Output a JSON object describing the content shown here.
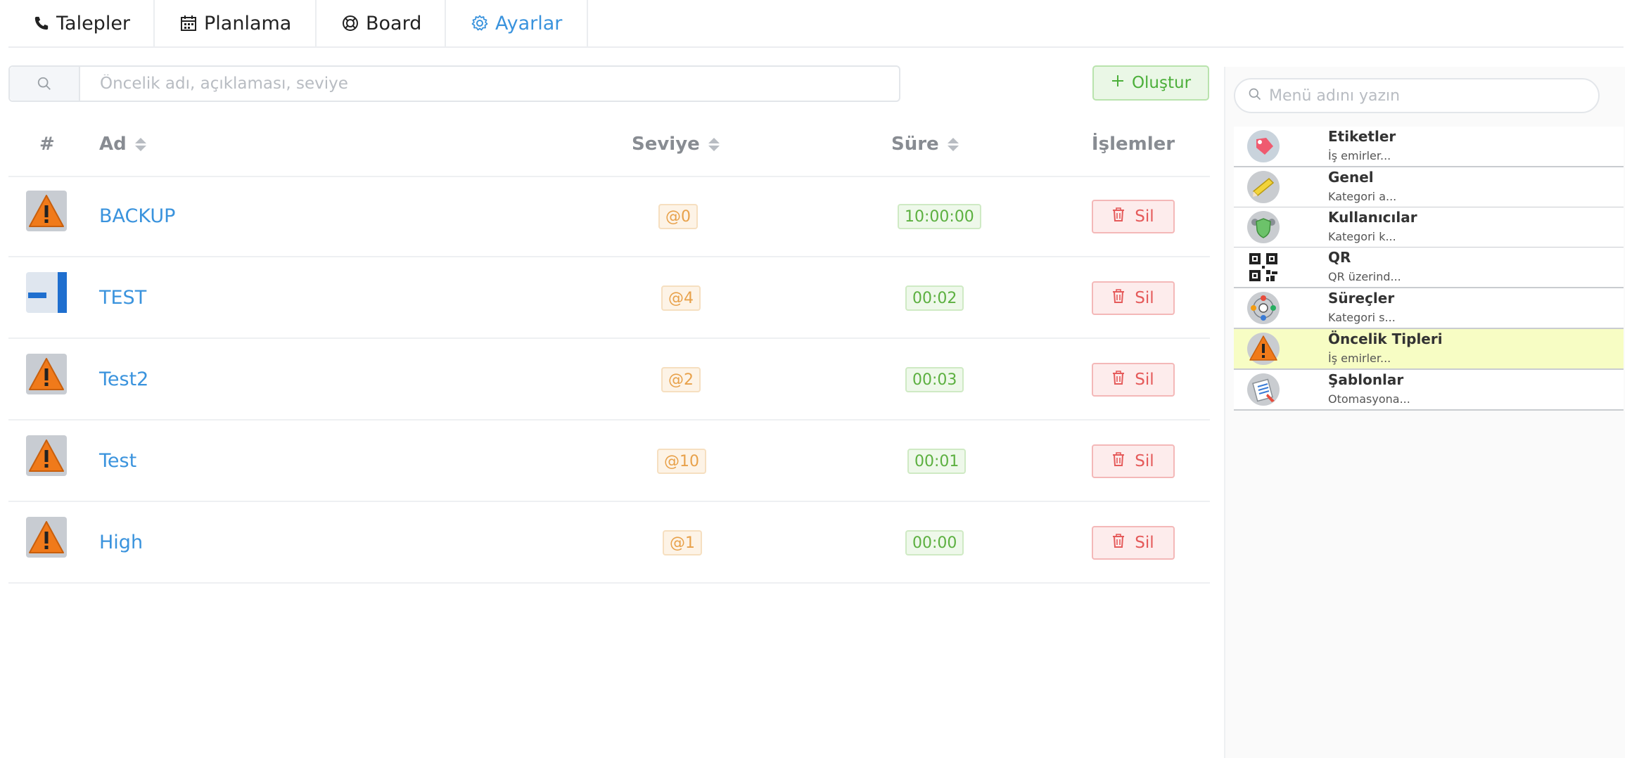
{
  "tabs": [
    {
      "label": "Talepler",
      "icon": "phone-icon",
      "active": false
    },
    {
      "label": "Planlama",
      "icon": "calendar-icon",
      "active": false
    },
    {
      "label": "Board",
      "icon": "lifebuoy-icon",
      "active": false
    },
    {
      "label": "Ayarlar",
      "icon": "gear-icon",
      "active": true
    }
  ],
  "search": {
    "placeholder": "Öncelik adı, açıklaması, seviye"
  },
  "toolbar": {
    "create_label": "Oluştur"
  },
  "table": {
    "headers": {
      "index": "#",
      "name": "Ad",
      "level": "Seviye",
      "duration": "Süre",
      "actions": "İşlemler"
    },
    "rows": [
      {
        "icon": "warning-icon",
        "name": "BACKUP",
        "level": "@0",
        "duration": "10:00:00",
        "delete": "Sil"
      },
      {
        "icon": "blue-square-icon",
        "name": "TEST",
        "level": "@4",
        "duration": "00:02",
        "delete": "Sil"
      },
      {
        "icon": "warning-icon",
        "name": "Test2",
        "level": "@2",
        "duration": "00:03",
        "delete": "Sil"
      },
      {
        "icon": "warning-icon",
        "name": "Test",
        "level": "@10",
        "duration": "00:01",
        "delete": "Sil"
      },
      {
        "icon": "warning-icon",
        "name": "High",
        "level": "@1",
        "duration": "00:00",
        "delete": "Sil"
      }
    ]
  },
  "menu": {
    "search_placeholder": "Menü adını yazın",
    "items": [
      {
        "title": "Etiketler",
        "desc": "İş emirler...",
        "icon": "tag-icon",
        "active": false
      },
      {
        "title": "Genel",
        "desc": "Kategori a...",
        "icon": "pencil-icon",
        "active": false
      },
      {
        "title": "Kullanıcılar",
        "desc": "Kategori k...",
        "icon": "users-shield-icon",
        "active": false
      },
      {
        "title": "QR",
        "desc": "QR üzerind...",
        "icon": "qr-code-icon",
        "active": false
      },
      {
        "title": "Süreçler",
        "desc": "Kategori s...",
        "icon": "process-network-icon",
        "active": false
      },
      {
        "title": "Öncelik Tipleri",
        "desc": "İş emirler...",
        "icon": "warning-icon",
        "active": true
      },
      {
        "title": "Şablonlar",
        "desc": "Otomasyona...",
        "icon": "template-pen-icon",
        "active": false
      }
    ]
  },
  "colors": {
    "accent": "#3a93dd",
    "success": "#4caf3a",
    "danger": "#e55a5a",
    "warning": "#e8a14a",
    "highlight": "#f7fdc4"
  }
}
